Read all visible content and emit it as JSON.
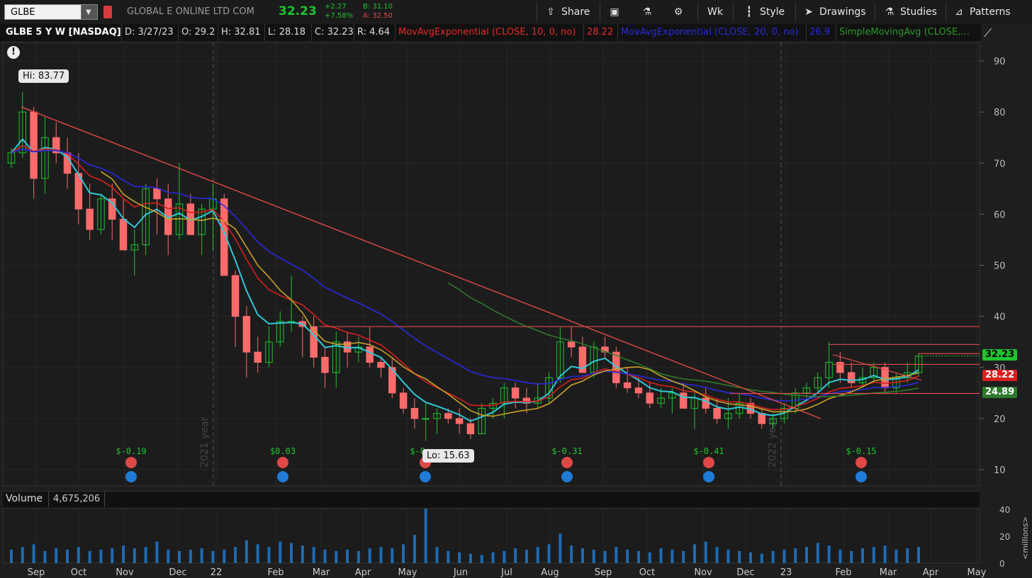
{
  "symbol": "GLBE",
  "company": "GLOBAL E ONLINE LTD COM",
  "last": "32.23",
  "change": "+2.27",
  "change_pct": "+7.58%",
  "bid": "B: 31.10",
  "ask": "A: 32.50",
  "toolbar": {
    "share": "Share",
    "aggregation": "Wk",
    "style": "Style",
    "drawings": "Drawings",
    "studies": "Studies",
    "patterns": "Patterns"
  },
  "infobar": {
    "title": "GLBE 5 Y W [NASDAQ]",
    "date": "D: 3/27/23",
    "open": "O: 29.2",
    "high": "H: 32.81",
    "low": "L: 28.18",
    "close": "C: 32.23",
    "range": "R: 4.64",
    "study1": "MovAvgExponential (CLOSE, 10, 0, no)",
    "study1_value": "28.22",
    "study2": "MovAvgExponential (CLOSE, 20, 0, no)",
    "study2_value": "26.9",
    "study3": "SimpleMovingAvg (CLOSE,..."
  },
  "hi_label": "Hi: 83.77",
  "lo_label": "Lo: 15.63",
  "price_tags": {
    "last": "32.23",
    "ema10": "28.22",
    "sma": "24.89"
  },
  "volume": {
    "label": "Volume",
    "value": "4,675,206",
    "unit": "<millions>"
  },
  "year_markers": [
    "2021 year",
    "2022 year"
  ],
  "earnings": [
    {
      "label": "$-0.19",
      "x": "Nov"
    },
    {
      "label": "$0.03",
      "x": "Feb"
    },
    {
      "label": "$-0...",
      "x": "May"
    },
    {
      "label": "$-0.31",
      "x": "Aug"
    },
    {
      "label": "$-0.41",
      "x": "Nov"
    },
    {
      "label": "$-0.15",
      "x": "Feb"
    }
  ],
  "colors": {
    "up": "#1fc42f",
    "down": "#ff6b6b",
    "ema10": "#d62020",
    "ema20": "#2a2ae0",
    "sma_green": "#2d7a2d",
    "sma_yellow": "#c7a22a",
    "cyan": "#31c8d8",
    "trend": "#e04848"
  },
  "chart_data": {
    "type": "candlestick",
    "interval": "weekly",
    "y_axis_ticks": [
      10,
      20,
      30,
      40,
      50,
      60,
      70,
      80,
      90
    ],
    "ylim": [
      8,
      96
    ],
    "volume_ticks": [
      0,
      20,
      40
    ],
    "x_tick_labels": [
      "Sep",
      "Oct",
      "Nov",
      "Dec",
      "22",
      "Feb",
      "Mar",
      "Apr",
      "May",
      "Jun",
      "Jul",
      "Aug",
      "Sep",
      "Oct",
      "Nov",
      "Dec",
      "23",
      "Feb",
      "Mar",
      "Apr",
      "May"
    ],
    "ohlc": [
      [
        70,
        73,
        69,
        72
      ],
      [
        72,
        84,
        71,
        80
      ],
      [
        80,
        81,
        63,
        67
      ],
      [
        67,
        79,
        64,
        75
      ],
      [
        75,
        78,
        70,
        72
      ],
      [
        72,
        75,
        65,
        68
      ],
      [
        68,
        72,
        58,
        61
      ],
      [
        61,
        66,
        55,
        57
      ],
      [
        57,
        64,
        56,
        63
      ],
      [
        63,
        66,
        55,
        59
      ],
      [
        59,
        63,
        53,
        53
      ],
      [
        53,
        57,
        48,
        54
      ],
      [
        54,
        66,
        52,
        65
      ],
      [
        65,
        67,
        56,
        63
      ],
      [
        63,
        66,
        52,
        56
      ],
      [
        56,
        70,
        55,
        62
      ],
      [
        62,
        64,
        56,
        56
      ],
      [
        56,
        62,
        52,
        61
      ],
      [
        61,
        66,
        53,
        63
      ],
      [
        63,
        64,
        48,
        48
      ],
      [
        48,
        49,
        34,
        40
      ],
      [
        40,
        42,
        28,
        33
      ],
      [
        33,
        36,
        29,
        31
      ],
      [
        31,
        38,
        30,
        35
      ],
      [
        35,
        41,
        34,
        39
      ],
      [
        39,
        48,
        37,
        39
      ],
      [
        39,
        40,
        32,
        38
      ],
      [
        38,
        40,
        30,
        32
      ],
      [
        32,
        34,
        26,
        29
      ],
      [
        29,
        37,
        26,
        35
      ],
      [
        35,
        37,
        30,
        33
      ],
      [
        33,
        36,
        31,
        34
      ],
      [
        34,
        38,
        30,
        31
      ],
      [
        31,
        32,
        28,
        30
      ],
      [
        30,
        32,
        24,
        25
      ],
      [
        25,
        26,
        21,
        22
      ],
      [
        22,
        24,
        18,
        20
      ],
      [
        20,
        23,
        15.63,
        20
      ],
      [
        20,
        22,
        17,
        21
      ],
      [
        21,
        22,
        19,
        20
      ],
      [
        20,
        22,
        17,
        19
      ],
      [
        19,
        20,
        16,
        17
      ],
      [
        17,
        23,
        17,
        22
      ],
      [
        22,
        24,
        20,
        23
      ],
      [
        23,
        27,
        20,
        26
      ],
      [
        26,
        27,
        22,
        24
      ],
      [
        24,
        26,
        21,
        23
      ],
      [
        23,
        27,
        22,
        24
      ],
      [
        24,
        29,
        23,
        28
      ],
      [
        28,
        38,
        27,
        35
      ],
      [
        35,
        38,
        32,
        34
      ],
      [
        34,
        36,
        31,
        29
      ],
      [
        29,
        35,
        28,
        34
      ],
      [
        34,
        36,
        32,
        33
      ],
      [
        33,
        34,
        26,
        27
      ],
      [
        27,
        30,
        25,
        26
      ],
      [
        26,
        28,
        24,
        25
      ],
      [
        25,
        27,
        22,
        23
      ],
      [
        23,
        26,
        22,
        24
      ],
      [
        24,
        26,
        21,
        25
      ],
      [
        25,
        27,
        22,
        22
      ],
      [
        22,
        25,
        18,
        24
      ],
      [
        24,
        26,
        21,
        22
      ],
      [
        22,
        24,
        19,
        20
      ],
      [
        20,
        24,
        18,
        21
      ],
      [
        21,
        25,
        20,
        23
      ],
      [
        23,
        24,
        20,
        21
      ],
      [
        21,
        22,
        18,
        19
      ],
      [
        19,
        21,
        18,
        20
      ],
      [
        20,
        23,
        19,
        22
      ],
      [
        22,
        26,
        21,
        25
      ],
      [
        25,
        27,
        24,
        26
      ],
      [
        26,
        29,
        25,
        28
      ],
      [
        28,
        35,
        26,
        31
      ],
      [
        31,
        33,
        27,
        29
      ],
      [
        29,
        31,
        26,
        27
      ],
      [
        27,
        30,
        26,
        28
      ],
      [
        28,
        31,
        27,
        30
      ],
      [
        30,
        31,
        25,
        26
      ],
      [
        26,
        29,
        25,
        28
      ],
      [
        28,
        31,
        27,
        29
      ],
      [
        29,
        32.81,
        28.18,
        32.23
      ]
    ],
    "volume": [
      10,
      12,
      14,
      9,
      11,
      10,
      12,
      9,
      10,
      11,
      13,
      11,
      12,
      16,
      10,
      9,
      10,
      11,
      9,
      10,
      12,
      17,
      14,
      12,
      16,
      15,
      13,
      12,
      10,
      9,
      10,
      9,
      11,
      12,
      11,
      14,
      21,
      50,
      12,
      9,
      8,
      7,
      6,
      8,
      9,
      11,
      10,
      12,
      14,
      22,
      13,
      11,
      10,
      9,
      12,
      10,
      9,
      8,
      11,
      10,
      9,
      14,
      16,
      12,
      10,
      9,
      8,
      7,
      9,
      10,
      11,
      12,
      15,
      13,
      10,
      9,
      11,
      12,
      13,
      10,
      11,
      12
    ]
  }
}
